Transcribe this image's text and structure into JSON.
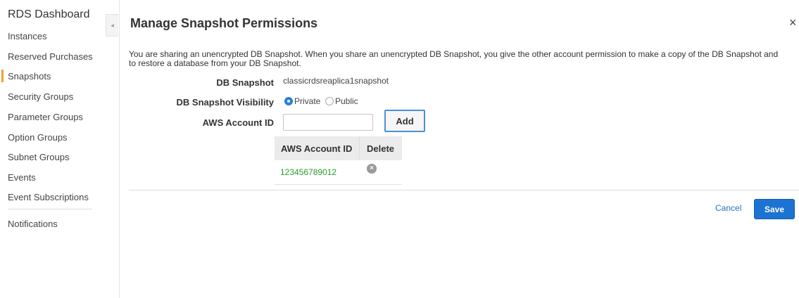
{
  "sidebar": {
    "title": "RDS Dashboard",
    "items": [
      {
        "label": "Instances"
      },
      {
        "label": "Reserved Purchases"
      },
      {
        "label": "Snapshots"
      },
      {
        "label": "Security Groups"
      },
      {
        "label": "Parameter Groups"
      },
      {
        "label": "Option Groups"
      },
      {
        "label": "Subnet Groups"
      },
      {
        "label": "Events"
      },
      {
        "label": "Event Subscriptions"
      },
      {
        "label": "Notifications"
      }
    ],
    "active_item": "Snapshots",
    "collapse_glyph": "◂"
  },
  "modal": {
    "title": "Manage Snapshot Permissions",
    "close_glyph": "×",
    "intro": "You are sharing an unencrypted DB Snapshot. When you share an unencrypted DB Snapshot, you give the other account permission to make a copy of the DB Snapshot and to restore a database from your DB Snapshot.",
    "fields": {
      "snapshot_label": "DB Snapshot",
      "snapshot_value": "classicrdsreaplica1snapshot",
      "visibility_label": "DB Snapshot Visibility",
      "visibility_options": [
        "Private",
        "Public"
      ],
      "visibility_selected": "Private",
      "account_label": "AWS Account ID",
      "account_value": "",
      "add_label": "Add"
    },
    "table": {
      "headers": [
        "AWS Account ID",
        "Delete"
      ],
      "rows": [
        {
          "account_id": "123456789012",
          "delete_icon": "circle-x-icon"
        }
      ]
    },
    "actions": {
      "cancel_label": "Cancel",
      "save_label": "Save"
    }
  },
  "colors": {
    "primary": "#1c73d1",
    "active_marker": "#f0a030",
    "account_id_text": "#2a9a2a"
  }
}
